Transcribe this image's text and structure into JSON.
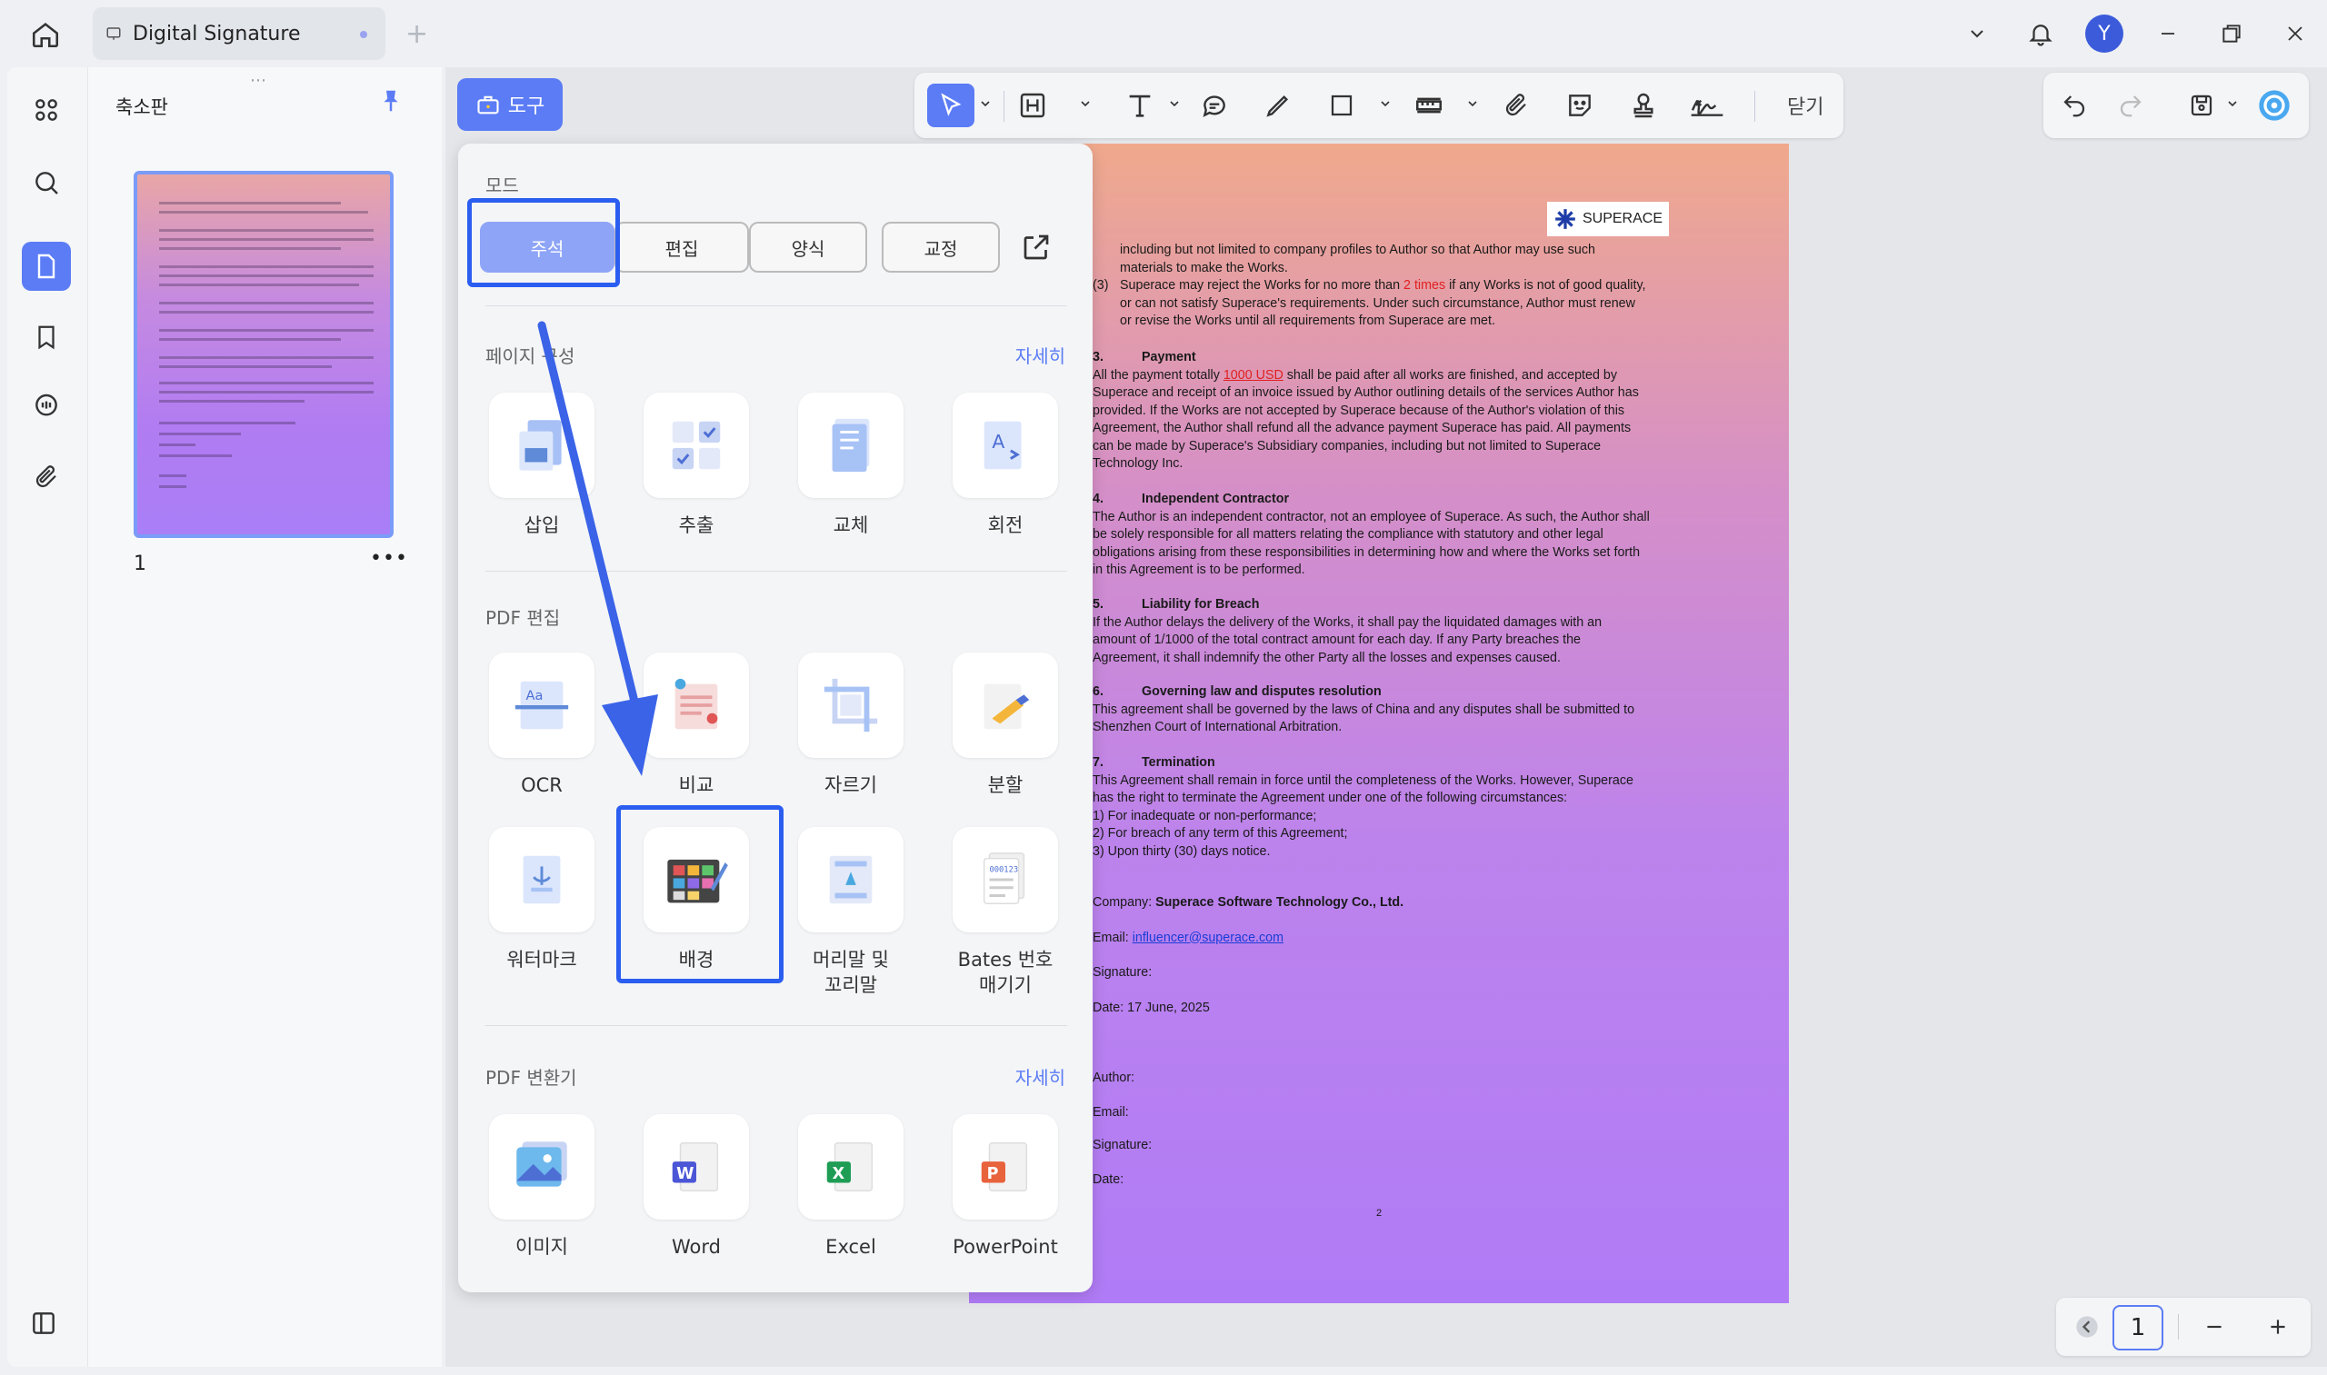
{
  "tabs": [
    {
      "label": "Digital Signature"
    }
  ],
  "user": {
    "initial": "Y"
  },
  "thumbnails": {
    "title": "축소판",
    "page_number": "1"
  },
  "toolbar": {
    "tool_label": "도구",
    "close_label": "닫기"
  },
  "dropdown": {
    "mode_label": "모드",
    "modes": [
      "주석",
      "편집",
      "양식",
      "교정"
    ],
    "sections": [
      {
        "title": "페이지 구성",
        "more": "자세히",
        "items": [
          "삽입",
          "추출",
          "교체",
          "회전"
        ]
      },
      {
        "title": "PDF 편집",
        "items": [
          "OCR",
          "비교",
          "자르기",
          "분할",
          "워터마크",
          "배경",
          "머리말 및\n꼬리말",
          "Bates 번호\n매기기"
        ]
      },
      {
        "title": "PDF 변환기",
        "more": "자세히",
        "items": [
          "이미지",
          "Word",
          "Excel",
          "PowerPoint"
        ]
      }
    ]
  },
  "document": {
    "logo": "SUPERACE",
    "para_intro_1": "including but not limited to company profiles to Author so that Author may use such",
    "para_intro_2": "materials to make the Works.",
    "item3_num": "(3)",
    "item3_a": "Superace may reject the Works for no more than ",
    "item3_red": "2 times",
    "item3_b": " if any Works is not of good quality,",
    "item3_c": "or can not satisfy Superace's requirements. Under such circumstance, Author must renew",
    "item3_d": "or revise the Works until all requirements from Superace are met.",
    "s3_num": "3.",
    "s3_title": "Payment",
    "s3_a": "All the payment totally ",
    "s3_red": "1000 USD",
    "s3_b": " shall be paid after all works are finished, and accepted by",
    "s3_c": "Superace and receipt of an invoice issued by Author outlining details of the services Author has",
    "s3_d": "provided. If the Works are not accepted by Superace because of the Author's violation of this",
    "s3_e": "Agreement, the Author shall refund all the advance payment Superace has paid. All payments",
    "s3_f": "can be made by Superace's Subsidiary companies, including but not limited to Superace",
    "s3_g": "Technology Inc.",
    "s4_num": "4.",
    "s4_title": "Independent Contractor",
    "s4_a": "The Author is an independent contractor, not an employee of Superace. As such, the Author shall",
    "s4_b": "be solely responsible for all matters relating the compliance with statutory and other legal",
    "s4_c": "obligations arising from these responsibilities in determining how and where the Works set forth",
    "s4_d": "in this Agreement is to be performed.",
    "s5_num": "5.",
    "s5_title": "Liability for Breach",
    "s5_a": "If the Author delays the delivery of the Works, it shall pay the liquidated damages with an",
    "s5_b": "amount of 1/1000 of the total contract amount for each day. If any Party breaches the",
    "s5_c": "Agreement, it shall indemnify the other Party all the losses and expenses caused.",
    "s6_num": "6.",
    "s6_title": "Governing law and disputes resolution",
    "s6_a": "This agreement shall be governed by the laws of China and any disputes shall be submitted to",
    "s6_b": "Shenzhen Court of International Arbitration.",
    "s7_num": "7.",
    "s7_title": "Termination",
    "s7_a": "This Agreement shall remain in force until the completeness of the Works. However, Superace",
    "s7_b": "has the right to terminate the Agreement under one of the following circumstances:",
    "s7_c": "1) For inadequate or non-performance;",
    "s7_d": "2) For breach of any term of this Agreement;",
    "s7_e": "3)  Upon thirty (30) days notice.",
    "company_label": "Company: ",
    "company_value": "Superace Software Technology Co., Ltd.",
    "email_label": "Email: ",
    "email_value": "influencer@superace.com",
    "signature_label": "Signature:",
    "date_line": "Date: 17 June, 2025",
    "author_label": "Author:",
    "email2_label": "Email:",
    "signature2_label": "Signature:",
    "date2_label": "Date:",
    "page_footer": "2"
  },
  "pagenav": {
    "current": "1"
  }
}
